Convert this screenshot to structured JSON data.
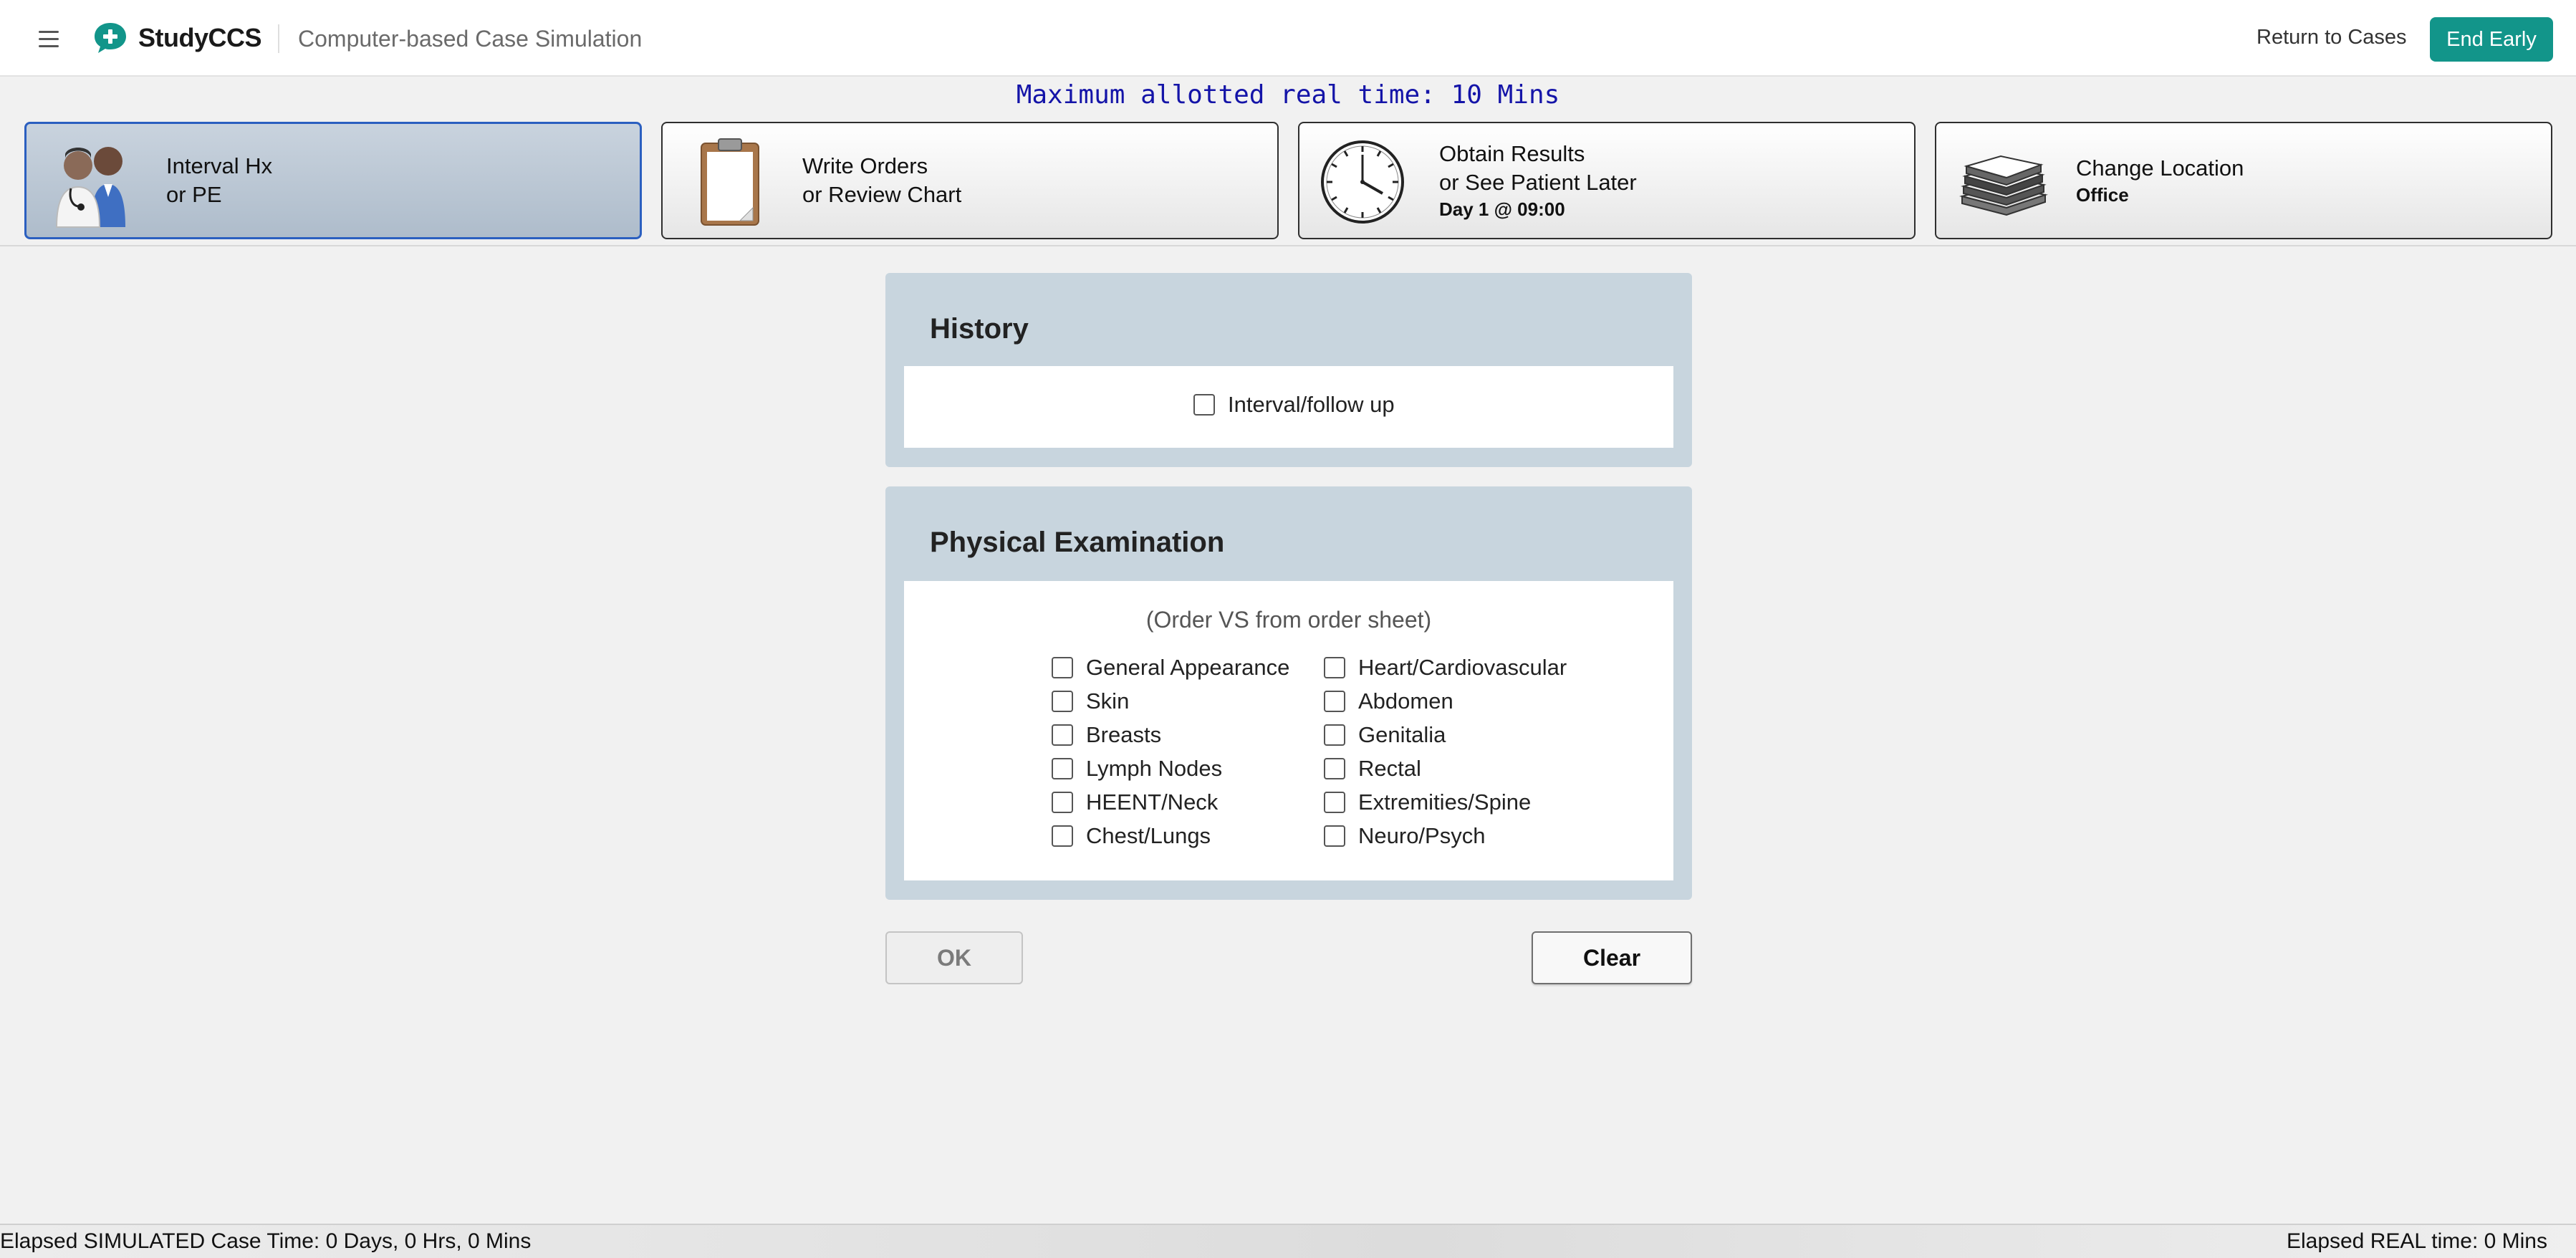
{
  "header": {
    "brand": "StudyCCS",
    "subtitle": "Computer-based Case Simulation",
    "return_label": "Return to Cases",
    "end_label": "End Early",
    "accent_color": "#12958a"
  },
  "max_time": "Maximum allotted real time: 10 Mins",
  "tiles": [
    {
      "line1": "Interval Hx",
      "line2": "or PE",
      "icon": "doctor-icon",
      "active": true
    },
    {
      "line1": "Write Orders",
      "line2": "or Review Chart",
      "icon": "clipboard-icon",
      "active": false
    },
    {
      "line1": "Obtain Results",
      "line2": "or See Patient Later",
      "sub": "Day 1 @ 09:00",
      "icon": "clock-icon",
      "active": false
    },
    {
      "line1": "Change Location",
      "sub": "Office",
      "icon": "building-icon",
      "active": false
    }
  ],
  "history": {
    "title": "History",
    "items": [
      "Interval/follow up"
    ]
  },
  "exam": {
    "title": "Physical Examination",
    "note": "(Order VS from order sheet)",
    "left": [
      "General Appearance",
      "Skin",
      "Breasts",
      "Lymph Nodes",
      "HEENT/Neck",
      "Chest/Lungs"
    ],
    "right": [
      "Heart/Cardiovascular",
      "Abdomen",
      "Genitalia",
      "Rectal",
      "Extremities/Spine",
      "Neuro/Psych"
    ]
  },
  "buttons": {
    "ok": "OK",
    "clear": "Clear"
  },
  "status": {
    "simulated": "Elapsed SIMULATED Case Time: 0 Days, 0 Hrs, 0 Mins",
    "real": "Elapsed REAL time: 0 Mins"
  }
}
